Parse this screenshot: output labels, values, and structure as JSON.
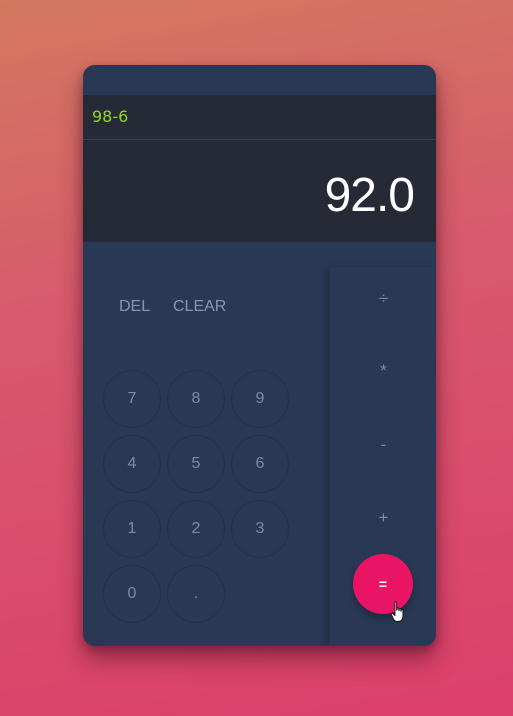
{
  "display": {
    "expression": "98-6",
    "result": "92.0"
  },
  "controls": {
    "del_label": "DEL",
    "clear_label": "CLEAR"
  },
  "digits": {
    "seven": "7",
    "eight": "8",
    "nine": "9",
    "four": "4",
    "five": "5",
    "six": "6",
    "one": "1",
    "two": "2",
    "three": "3",
    "zero": "0",
    "dot": "."
  },
  "operators": {
    "divide": "÷",
    "multiply": "*",
    "subtract": "-",
    "add": "+",
    "equals": "="
  },
  "colors": {
    "accent": "#e91463",
    "expression_text": "#8fd92a",
    "panel": "#293955",
    "display_bg": "#252a36"
  },
  "icons": {
    "pointer": "hand-pointer-icon"
  }
}
